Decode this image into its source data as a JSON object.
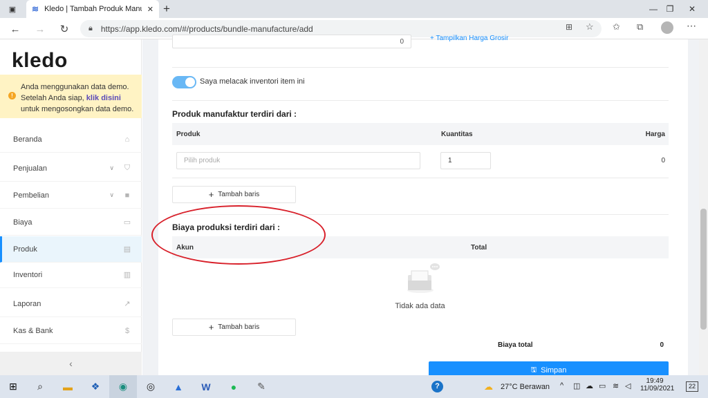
{
  "browser": {
    "tab_title": "Kledo | Tambah Produk Manufak",
    "url": "https://app.kledo.com/#/products/bundle-manufacture/add"
  },
  "sidebar": {
    "logo": "kledo",
    "demo_text_1": "Anda menggunakan data demo. Setelah Anda siap, ",
    "demo_link": "klik disini",
    "demo_text_2": " untuk mengosongkan data demo.",
    "items": [
      {
        "label": "Beranda"
      },
      {
        "label": "Penjualan"
      },
      {
        "label": "Pembelian"
      },
      {
        "label": "Biaya"
      },
      {
        "label": "Produk"
      },
      {
        "label": "Inventori"
      },
      {
        "label": "Laporan"
      },
      {
        "label": "Kas & Bank"
      }
    ],
    "collapse_icon": "‹"
  },
  "form": {
    "top_value": "0",
    "grosir_link": "Tampilkan Harga Grosir",
    "track_label": "Saya melacak inventori item ini",
    "section1_title": "Produk manufaktur terdiri dari :",
    "section1_cols": {
      "produk": "Produk",
      "kuantitas": "Kuantitas",
      "harga": "Harga"
    },
    "section1_row": {
      "product_placeholder": "Pilih produk",
      "qty": "1",
      "price": "0"
    },
    "add_row": "Tambah baris",
    "section2_title": "Biaya produksi terdiri dari :",
    "section2_cols": {
      "akun": "Akun",
      "total": "Total"
    },
    "empty_text": "Tidak ada data",
    "total_label": "Biaya total",
    "total_value": "0",
    "save": "Simpan"
  },
  "taskbar": {
    "weather": "27°C  Berawan",
    "time": "19:49",
    "date": "11/09/2021",
    "notif_count": "22"
  },
  "colors": {
    "primary": "#1890ff",
    "annotation": "#d8202a",
    "demo_bg": "#fff3c4"
  }
}
